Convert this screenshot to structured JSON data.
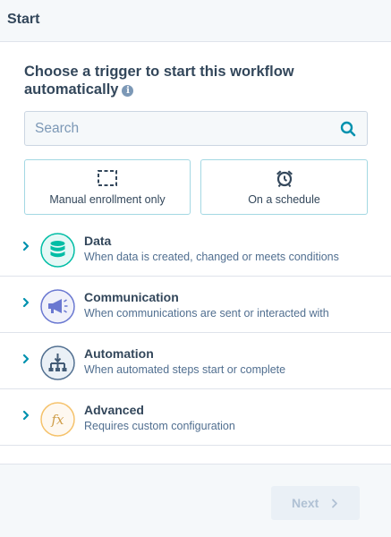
{
  "header": {
    "title": "Start"
  },
  "heading": {
    "text": "Choose a trigger to start this workflow automatically",
    "info_icon": "info-icon"
  },
  "search": {
    "placeholder": "Search",
    "value": "",
    "icon": "search-icon"
  },
  "options": [
    {
      "label": "Manual enrollment only",
      "icon": "dashed-square-icon"
    },
    {
      "label": "On a schedule",
      "icon": "alarm-clock-icon"
    }
  ],
  "categories": [
    {
      "title": "Data",
      "description": "When data is created, changed or meets conditions",
      "icon": "database-icon",
      "color": "#00bda5"
    },
    {
      "title": "Communication",
      "description": "When communications are sent or interacted with",
      "icon": "megaphone-icon",
      "color": "#6a78d1"
    },
    {
      "title": "Automation",
      "description": "When automated steps start or complete",
      "icon": "workflow-icon",
      "color": "#516f90"
    },
    {
      "title": "Advanced",
      "description": "Requires custom configuration",
      "icon": "function-icon",
      "color": "#f5c26b"
    }
  ],
  "footer": {
    "next_label": "Next"
  },
  "colors": {
    "accent": "#0091ae",
    "text": "#33475b",
    "border": "#dfe3eb"
  }
}
